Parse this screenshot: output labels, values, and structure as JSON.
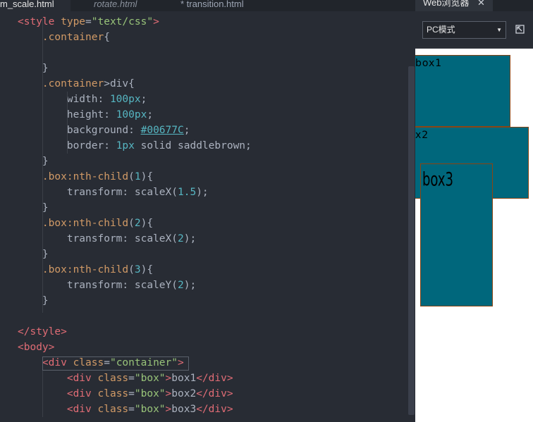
{
  "tabs": [
    {
      "label": "m_scale.html"
    },
    {
      "label": "rotate.html"
    },
    {
      "label": "* transition.html"
    }
  ],
  "code_lines": [
    [
      [
        "t-tag",
        "<style "
      ],
      [
        "t-attr",
        "type"
      ],
      [
        "t-def",
        "="
      ],
      [
        "t-str",
        "\"text/css\""
      ],
      [
        "t-tag",
        ">"
      ]
    ],
    [
      [
        "t-sel",
        "    .container"
      ],
      [
        "t-def",
        "{"
      ]
    ],
    [
      [
        "t-def",
        ""
      ]
    ],
    [
      [
        "t-def",
        "    }"
      ]
    ],
    [
      [
        "t-sel",
        "    .container"
      ],
      [
        "t-def",
        ">div{"
      ]
    ],
    [
      [
        "t-prop",
        "        width: "
      ],
      [
        "t-num",
        "100px"
      ],
      [
        "t-def",
        ";"
      ]
    ],
    [
      [
        "t-prop",
        "        height: "
      ],
      [
        "t-num",
        "100px"
      ],
      [
        "t-def",
        ";"
      ]
    ],
    [
      [
        "t-prop",
        "        background: "
      ],
      [
        "t-hex",
        "#00677C"
      ],
      [
        "t-def",
        ";"
      ]
    ],
    [
      [
        "t-prop",
        "        border: "
      ],
      [
        "t-num",
        "1px"
      ],
      [
        "t-def",
        " solid saddlebrown;"
      ]
    ],
    [
      [
        "t-def",
        "    }"
      ]
    ],
    [
      [
        "t-sel",
        "    .box:nth-child"
      ],
      [
        "t-def",
        "("
      ],
      [
        "t-num",
        "1"
      ],
      [
        "t-def",
        "){"
      ]
    ],
    [
      [
        "t-prop",
        "        transform: scaleX("
      ],
      [
        "t-num",
        "1.5"
      ],
      [
        "t-def",
        ");"
      ]
    ],
    [
      [
        "t-def",
        "    }"
      ]
    ],
    [
      [
        "t-sel",
        "    .box:nth-child"
      ],
      [
        "t-def",
        "("
      ],
      [
        "t-num",
        "2"
      ],
      [
        "t-def",
        "){"
      ]
    ],
    [
      [
        "t-prop",
        "        transform: scaleX("
      ],
      [
        "t-num",
        "2"
      ],
      [
        "t-def",
        ");"
      ]
    ],
    [
      [
        "t-def",
        "    }"
      ]
    ],
    [
      [
        "t-sel",
        "    .box:nth-child"
      ],
      [
        "t-def",
        "("
      ],
      [
        "t-num",
        "3"
      ],
      [
        "t-def",
        "){"
      ]
    ],
    [
      [
        "t-prop",
        "        transform: scaleY("
      ],
      [
        "t-num",
        "2"
      ],
      [
        "t-def",
        ");"
      ]
    ],
    [
      [
        "t-def",
        "    }"
      ]
    ],
    [
      [
        "t-def",
        ""
      ]
    ],
    [
      [
        "t-tag",
        "</style>"
      ]
    ],
    [
      [
        "t-tag",
        "<body>"
      ]
    ],
    [
      [
        "t-tag",
        "    <div "
      ],
      [
        "t-attr",
        "class"
      ],
      [
        "t-def",
        "="
      ],
      [
        "t-str",
        "\"container\""
      ],
      [
        "t-tag",
        ">"
      ]
    ],
    [
      [
        "t-tag",
        "        <div "
      ],
      [
        "t-attr",
        "class"
      ],
      [
        "t-def",
        "="
      ],
      [
        "t-str",
        "\"box\""
      ],
      [
        "t-tag",
        ">"
      ],
      [
        "t-def",
        "box1"
      ],
      [
        "t-tag",
        "</div>"
      ]
    ],
    [
      [
        "t-tag",
        "        <div "
      ],
      [
        "t-attr",
        "class"
      ],
      [
        "t-def",
        "="
      ],
      [
        "t-str",
        "\"box\""
      ],
      [
        "t-tag",
        ">"
      ],
      [
        "t-def",
        "box2"
      ],
      [
        "t-tag",
        "</div>"
      ]
    ],
    [
      [
        "t-tag",
        "        <div "
      ],
      [
        "t-attr",
        "class"
      ],
      [
        "t-def",
        "="
      ],
      [
        "t-str",
        "\"box\""
      ],
      [
        "t-tag",
        ">"
      ],
      [
        "t-def",
        "box3"
      ],
      [
        "t-tag",
        "</div>"
      ]
    ]
  ],
  "browser": {
    "tab_title": "Web浏览器",
    "close_glyph": "✕",
    "mode_select": "PC模式",
    "boxes": [
      {
        "text": "box1",
        "color": "#00677C"
      },
      {
        "text": "x2",
        "color": "#00677C"
      },
      {
        "text": "box3",
        "color": "#00677C"
      }
    ]
  },
  "colors": {
    "editor_bg": "#282c34",
    "tag": "#e06c75",
    "attr": "#d19a66",
    "string": "#98c379",
    "number": "#56b6c2",
    "box_fill": "#00677C",
    "box_border": "saddlebrown"
  }
}
